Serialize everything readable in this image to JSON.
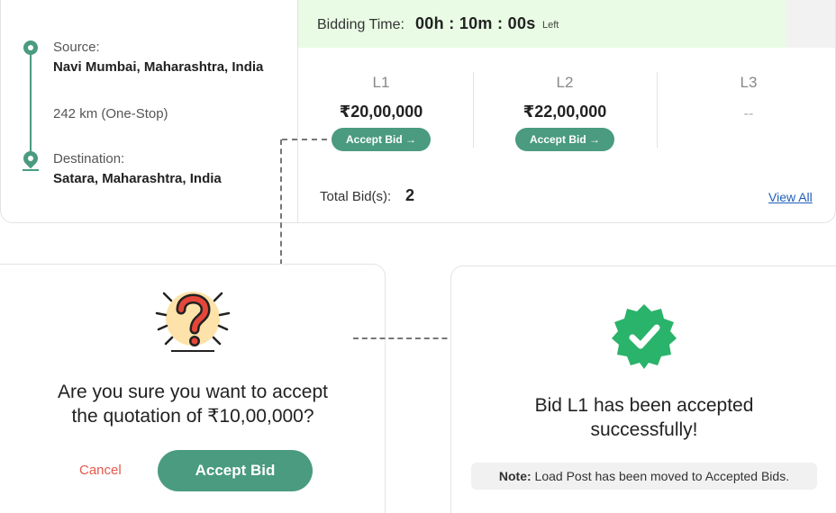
{
  "route": {
    "source_label": "Source:",
    "source_value": "Navi Mumbai, Maharashtra, India",
    "distance": "242 km (One-Stop)",
    "destination_label": "Destination:",
    "destination_value": "Satara, Maharashtra, India"
  },
  "timer": {
    "label": "Bidding Time:",
    "value": "00h : 10m : 00s",
    "suffix": "Left"
  },
  "bids": [
    {
      "rank": "L1",
      "price": "₹20,00,000",
      "action": "Accept Bid →"
    },
    {
      "rank": "L2",
      "price": "₹22,00,000",
      "action": "Accept Bid →"
    },
    {
      "rank": "L3",
      "price": "--"
    }
  ],
  "total": {
    "label": "Total Bid(s):",
    "value": "2",
    "view_all": "View All"
  },
  "confirm": {
    "line1": "Are you sure you want to accept",
    "line2": "the quotation of ₹10,00,000?",
    "cancel": "Cancel",
    "accept": "Accept Bid"
  },
  "success": {
    "line1": "Bid L1 has been accepted",
    "line2": "successfully!",
    "note_label": "Note:",
    "note_text": " Load Post has been moved to Accepted Bids."
  },
  "colors": {
    "accent": "#4a9b7f",
    "timer_bg": "#e9fbe5",
    "cancel": "#e5584c",
    "link": "#1f5fb7",
    "badge": "#2ab36a",
    "question_mark": "#e4473a"
  }
}
